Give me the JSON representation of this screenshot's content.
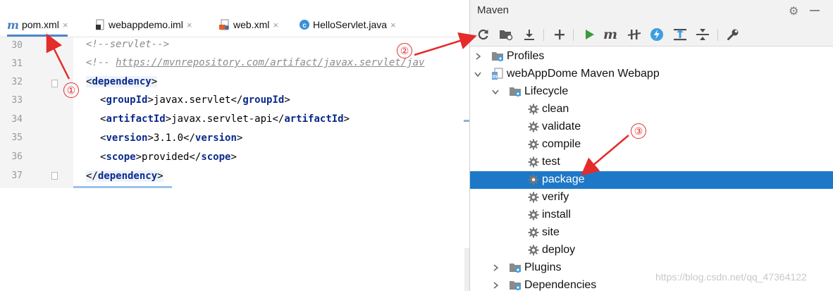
{
  "editor": {
    "tabs": [
      {
        "label": "pom.xml",
        "icon": "maven-m-icon",
        "active": true
      },
      {
        "label": "webappdemo.iml",
        "icon": "iml-file-icon"
      },
      {
        "label": "web.xml",
        "icon": "xml-file-icon"
      },
      {
        "label": "HelloServlet.java",
        "icon": "java-class-icon"
      }
    ],
    "close_glyph": "×",
    "line_numbers": [
      "30",
      "31",
      "32",
      "33",
      "34",
      "35",
      "36",
      "37"
    ],
    "code": {
      "l30": "<!--servlet-->",
      "l31_prefix": "<!-- ",
      "l31_link": "https://mvnrepository.com/artifact/javax.servlet/jav",
      "dependency_tag": "dependency",
      "groupId_tag": "groupId",
      "groupId_value": "javax.servlet",
      "artifactId_tag": "artifactId",
      "artifactId_value": "javax.servlet-api",
      "version_tag": "version",
      "version_value": "3.1.0",
      "scope_tag": "scope",
      "scope_value": "provided"
    }
  },
  "maven": {
    "title": "Maven",
    "toolbar": [
      "reimport-icon",
      "generate-sources-icon",
      "download-icon",
      "add-project-icon",
      "run-icon",
      "execute-goal-icon",
      "toggle-offline-icon",
      "skip-tests-icon",
      "show-dependencies-icon",
      "collapse-all-icon",
      "settings-wrench-icon"
    ],
    "tree": {
      "profiles": "Profiles",
      "project": "webAppDome Maven Webapp",
      "lifecycle": "Lifecycle",
      "goals": [
        "clean",
        "validate",
        "compile",
        "test",
        "package",
        "verify",
        "install",
        "site",
        "deploy"
      ],
      "selected_goal": "package",
      "plugins": "Plugins",
      "dependencies": "Dependencies"
    }
  },
  "annotations": {
    "markers": [
      "①",
      "②",
      "③"
    ],
    "color": "#e52b2b"
  },
  "watermark": "https://blog.csdn.net/qq_47364122",
  "colors": {
    "selection": "#1e78c8",
    "xml_tag": "#0b2a8a",
    "comment": "#8c8c8c",
    "run_green": "#3d9a3d"
  }
}
